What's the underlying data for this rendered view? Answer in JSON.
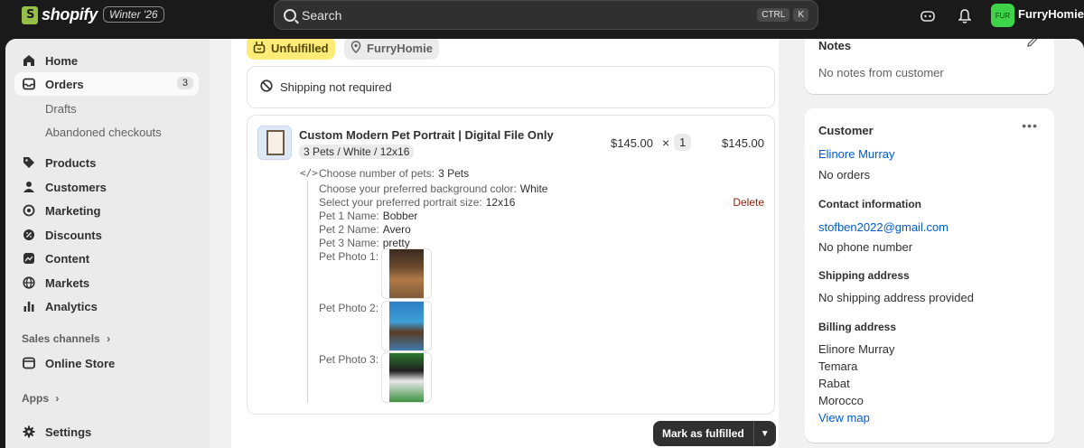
{
  "topbar": {
    "brand": "shopify",
    "edition": "Winter '26",
    "search_placeholder": "Search",
    "shortcut_ctrl": "CTRL",
    "shortcut_key": "K",
    "store_initials": "FUR",
    "store_name": "FurryHomie"
  },
  "sidebar": {
    "home": "Home",
    "orders": "Orders",
    "orders_count": "3",
    "drafts": "Drafts",
    "abandoned": "Abandoned checkouts",
    "products": "Products",
    "customers": "Customers",
    "marketing": "Marketing",
    "discounts": "Discounts",
    "content": "Content",
    "markets": "Markets",
    "analytics": "Analytics",
    "sales_channels": "Sales channels",
    "online_store": "Online Store",
    "apps": "Apps",
    "settings": "Settings"
  },
  "main": {
    "status_badge": "Unfulfilled",
    "location_badge": "FurryHomie",
    "shipping_note": "Shipping not required",
    "line_item": {
      "title": "Custom Modern Pet Portrait | Digital File Only",
      "variant": "3 Pets / White / 12x16",
      "price": "$145.00",
      "times": "×",
      "quantity": "1",
      "total": "$145.00",
      "delete": "Delete",
      "properties": [
        {
          "label": "Choose number of pets:",
          "value": "3 Pets"
        },
        {
          "label": "Choose your preferred background color:",
          "value": "White"
        },
        {
          "label": "Select your preferred portrait size:",
          "value": "12x16"
        },
        {
          "label": "Pet 1 Name:",
          "value": "Bobber"
        },
        {
          "label": "Pet 2 Name:",
          "value": "Avero"
        },
        {
          "label": "Pet 3 Name:",
          "value": "pretty"
        }
      ],
      "photos": [
        {
          "label": "Pet Photo 1:"
        },
        {
          "label": "Pet Photo 2:"
        },
        {
          "label": "Pet Photo 3:"
        }
      ]
    },
    "fulfill_button": "Mark as fulfilled"
  },
  "notes": {
    "title": "Notes",
    "text": "No notes from customer"
  },
  "customer": {
    "title": "Customer",
    "name": "Elinore Murray",
    "orders": "No orders",
    "contact_title": "Contact information",
    "email": "stofben2022@gmail.com",
    "phone": "No phone number",
    "shipping_title": "Shipping address",
    "shipping_text": "No shipping address provided",
    "billing_title": "Billing address",
    "billing_lines": [
      "Elinore Murray",
      "Temara",
      "Rabat",
      "Morocco"
    ],
    "view_map": "View map"
  }
}
